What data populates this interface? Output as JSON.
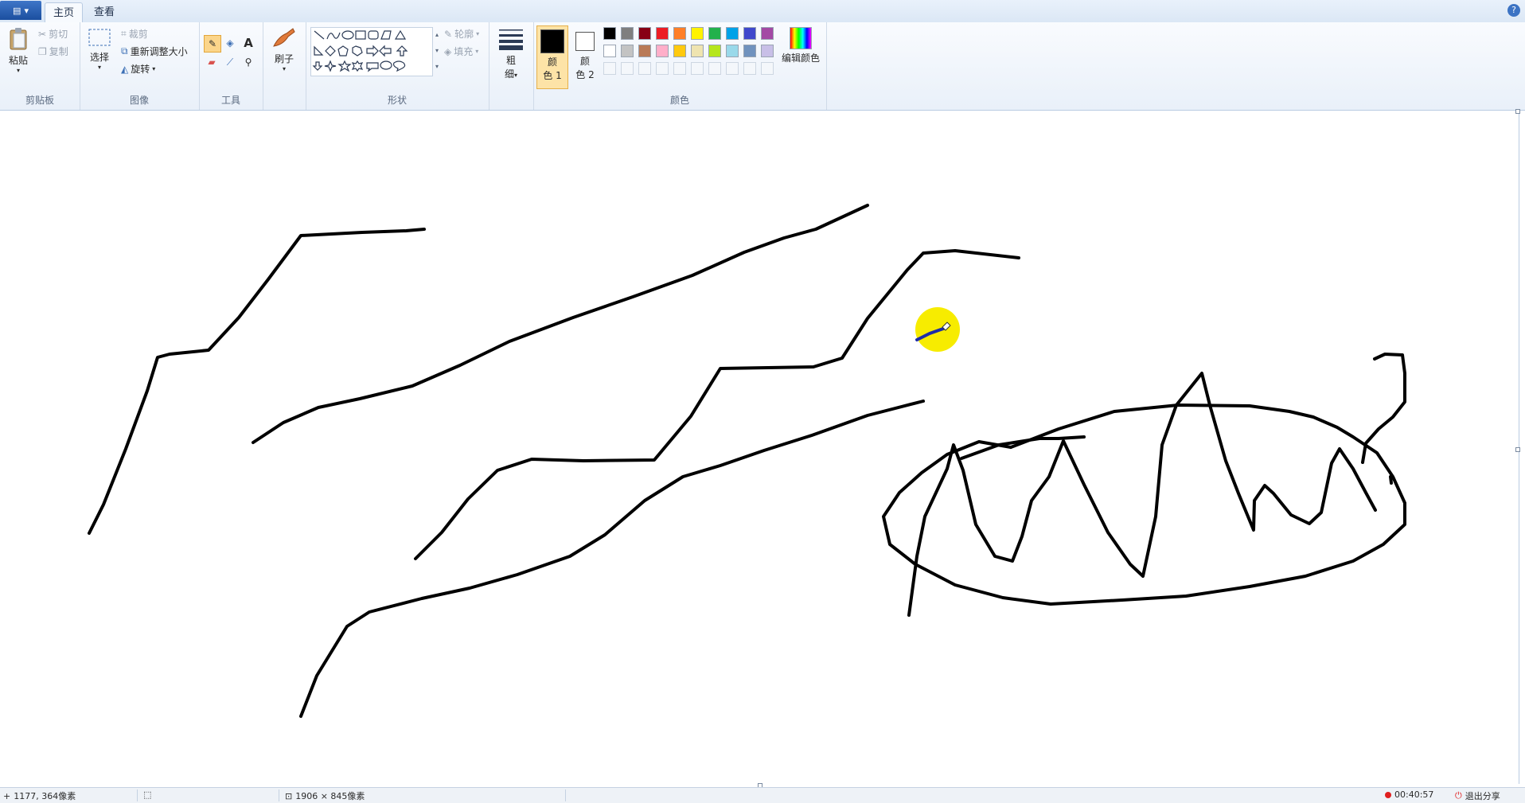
{
  "tabs": {
    "home": "主页",
    "view": "查看"
  },
  "clipboard": {
    "paste": "粘贴",
    "cut": "剪切",
    "copy": "复制",
    "label": "剪贴板"
  },
  "image": {
    "select": "选择",
    "crop": "裁剪",
    "resize": "重新调整大小",
    "rotate": "旋转",
    "label": "图像"
  },
  "tools": {
    "label": "工具"
  },
  "brushes": {
    "label": "刷子"
  },
  "shapes": {
    "outline": "轮廓",
    "fill": "填充",
    "label": "形状"
  },
  "size": {
    "line1": "粗",
    "line2": "细"
  },
  "colors": {
    "color1_l1": "颜",
    "color1_l2": "色 1",
    "color2_l1": "颜",
    "color2_l2": "色 2",
    "edit": "编辑颜色",
    "label": "颜色",
    "row1": [
      "#000000",
      "#7f7f7f",
      "#880015",
      "#ed1c24",
      "#ff7f27",
      "#fff200",
      "#22b14c",
      "#00a2e8",
      "#3f48cc",
      "#a349a4"
    ],
    "row2": [
      "#ffffff",
      "#c3c3c3",
      "#b97a57",
      "#ffaec9",
      "#ffc90e",
      "#efe4b0",
      "#b5e61d",
      "#99d9ea",
      "#7092be",
      "#c8bfe7"
    ]
  },
  "status": {
    "cursor_pos": "1177, 364像素",
    "canvas_size": "1906 × 845像素",
    "time": "00:40:57",
    "exit_share": "退出分享"
  }
}
